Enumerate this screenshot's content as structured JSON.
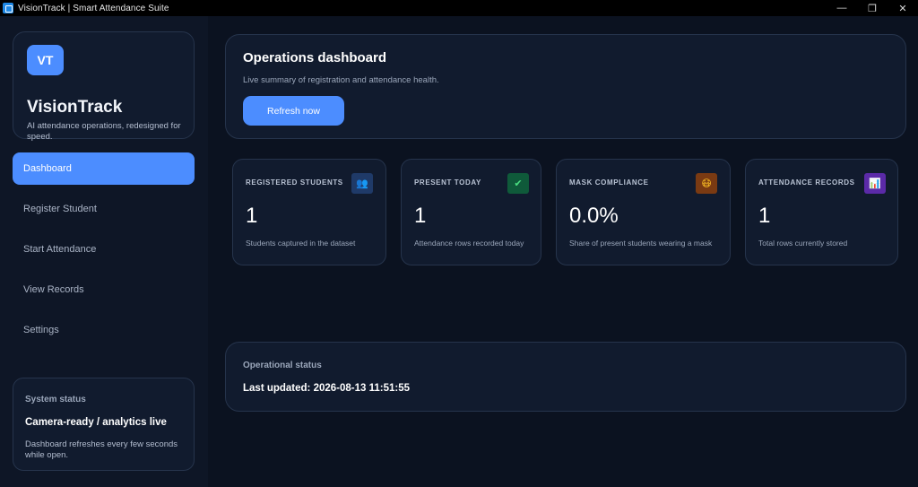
{
  "window": {
    "title": "VisionTrack | Smart Attendance Suite",
    "minimize_glyph": "—",
    "restore_glyph": "❐",
    "close_glyph": "✕"
  },
  "sidebar": {
    "brand": {
      "logo_text": "VT",
      "name": "VisionTrack",
      "tagline": "AI attendance operations, redesigned for speed."
    },
    "nav": [
      {
        "label": "Dashboard",
        "active": true
      },
      {
        "label": "Register Student",
        "active": false
      },
      {
        "label": "Start Attendance",
        "active": false
      },
      {
        "label": "View Records",
        "active": false
      },
      {
        "label": "Settings",
        "active": false
      }
    ],
    "system_status": {
      "label": "System status",
      "value": "Camera-ready / analytics live",
      "description": "Dashboard refreshes every few seconds while open."
    }
  },
  "header": {
    "title": "Operations dashboard",
    "subtitle": "Live summary of registration and attendance health.",
    "refresh_label": "Refresh now"
  },
  "stats": [
    {
      "label": "REGISTERED STUDENTS",
      "value": "1",
      "description": "Students captured in the dataset",
      "icon": "users-icon",
      "glyph": "👥",
      "icon_bg": "#1f3a68",
      "icon_fg": "#8fb4ff"
    },
    {
      "label": "PRESENT TODAY",
      "value": "1",
      "description": "Attendance rows recorded today",
      "icon": "check-icon",
      "glyph": "✔",
      "icon_bg": "#0f5a3a",
      "icon_fg": "#4ade80"
    },
    {
      "label": "MASK COMPLIANCE",
      "value": "0.0%",
      "description": "Share of present students wearing a mask",
      "icon": "mask-face-icon",
      "glyph": "😷",
      "icon_bg": "#7a3a12",
      "icon_fg": "#fbbf24"
    },
    {
      "label": "ATTENDANCE RECORDS",
      "value": "1",
      "description": "Total rows currently stored",
      "icon": "bar-chart-icon",
      "glyph": "📊",
      "icon_bg": "#5b2aa8",
      "icon_fg": "#e9d5ff"
    }
  ],
  "operational_status": {
    "label": "Operational status",
    "last_updated": "Last updated: 2026-08-13 11:51:55"
  },
  "colors": {
    "accent": "#4c8dff",
    "background": "#0b1220",
    "card": "#111b2e"
  }
}
